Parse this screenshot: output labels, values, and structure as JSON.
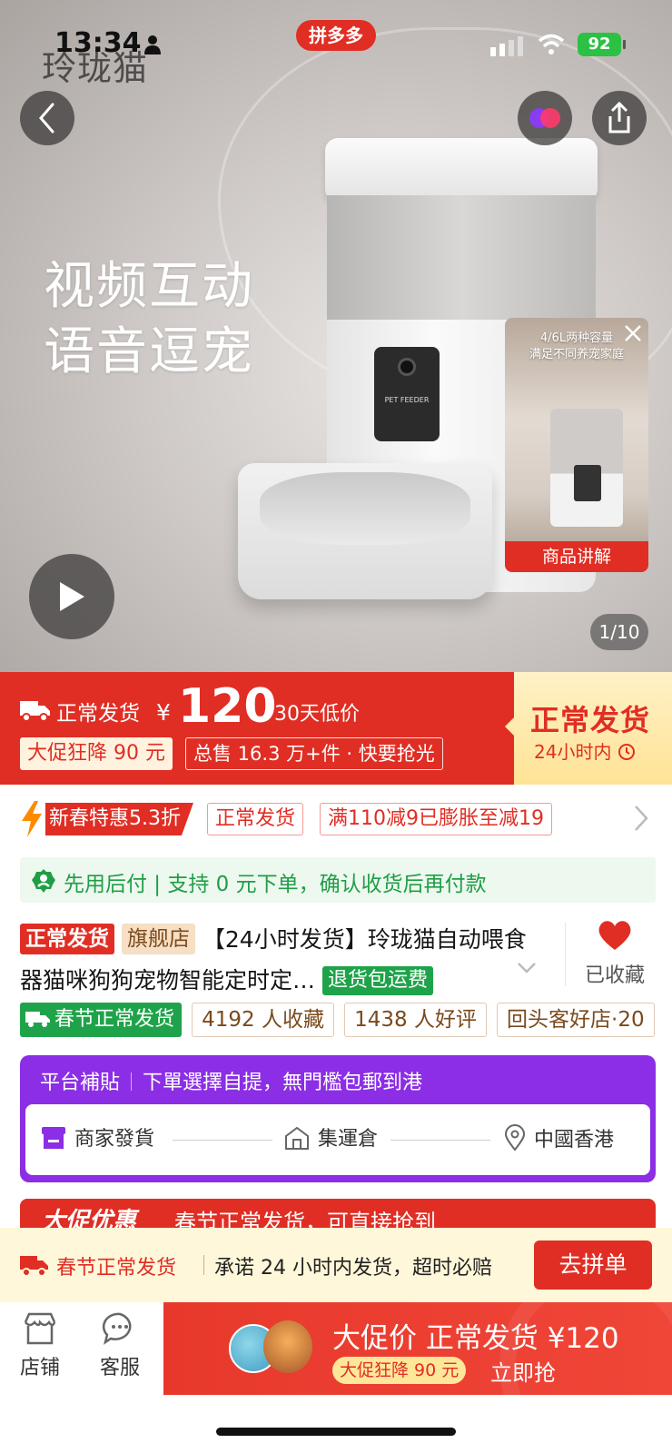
{
  "status_bar": {
    "time": "13:34",
    "app_badge": "拼多多",
    "battery": "92"
  },
  "hero": {
    "brand_logo": "玲珑猫",
    "slogan_line1": "视频互动",
    "slogan_line2": "语音逗宠",
    "device_label": "PET FEEDER",
    "video_thumb_text1": "4/6L两种容量",
    "video_thumb_text2": "满足不同养宠家庭",
    "video_thumb_label": "商品讲解",
    "page_counter": "1/10"
  },
  "price_banner": {
    "ship_label": "正常发货",
    "currency": "¥",
    "price": "120",
    "low_price_note": "30天低价",
    "promo_tag": "大促狂降 90 元",
    "sales_tag": "总售 16.3 万+件 · 快要抢光",
    "right_title": "正常发货",
    "right_sub": "24小时内"
  },
  "promo_row": {
    "spring_tag": "新春特惠5.3折",
    "normal_ship_tag": "正常发货",
    "coupon_tag": "满110减9已膨胀至减19"
  },
  "paylater": {
    "text": "先用后付 | 支持 0 元下单，确认收货后再付款"
  },
  "product": {
    "badge_normal": "正常发货",
    "badge_store": "旗舰店",
    "title": "【24小时发货】玲珑猫自动喂食器猫咪狗狗宠物智能定时定…",
    "badge_return": "退货包运费",
    "favorite_label": "已收藏"
  },
  "tags": {
    "spring_ship": "春节正常发货",
    "collect_count": "4192 人收藏",
    "good_reviews": "1438 人好评",
    "repeat_store": "回头客好店·20"
  },
  "subsidy": {
    "title": "平台補貼",
    "text": "下單選擇自提，無門檻包郵到港",
    "steps": [
      "商家發貨",
      "集運倉",
      "中國香港"
    ]
  },
  "next_bar": {
    "title": "大促优惠",
    "text": "春节正常发货，可直接抢到"
  },
  "commit_bar": {
    "title": "春节正常发货",
    "text": "承诺 24 小时内发货，超时必赔",
    "button": "去拼单"
  },
  "bottom_nav": {
    "store": "店铺",
    "service": "客服",
    "cta_title": "大促价 正常发货 ¥120",
    "cta_badge": "大促狂降 90 元",
    "cta_action": "立即抢"
  },
  "colors": {
    "brand_red": "#e02e24",
    "green": "#1fa34a",
    "purple": "#8b2ee5"
  }
}
